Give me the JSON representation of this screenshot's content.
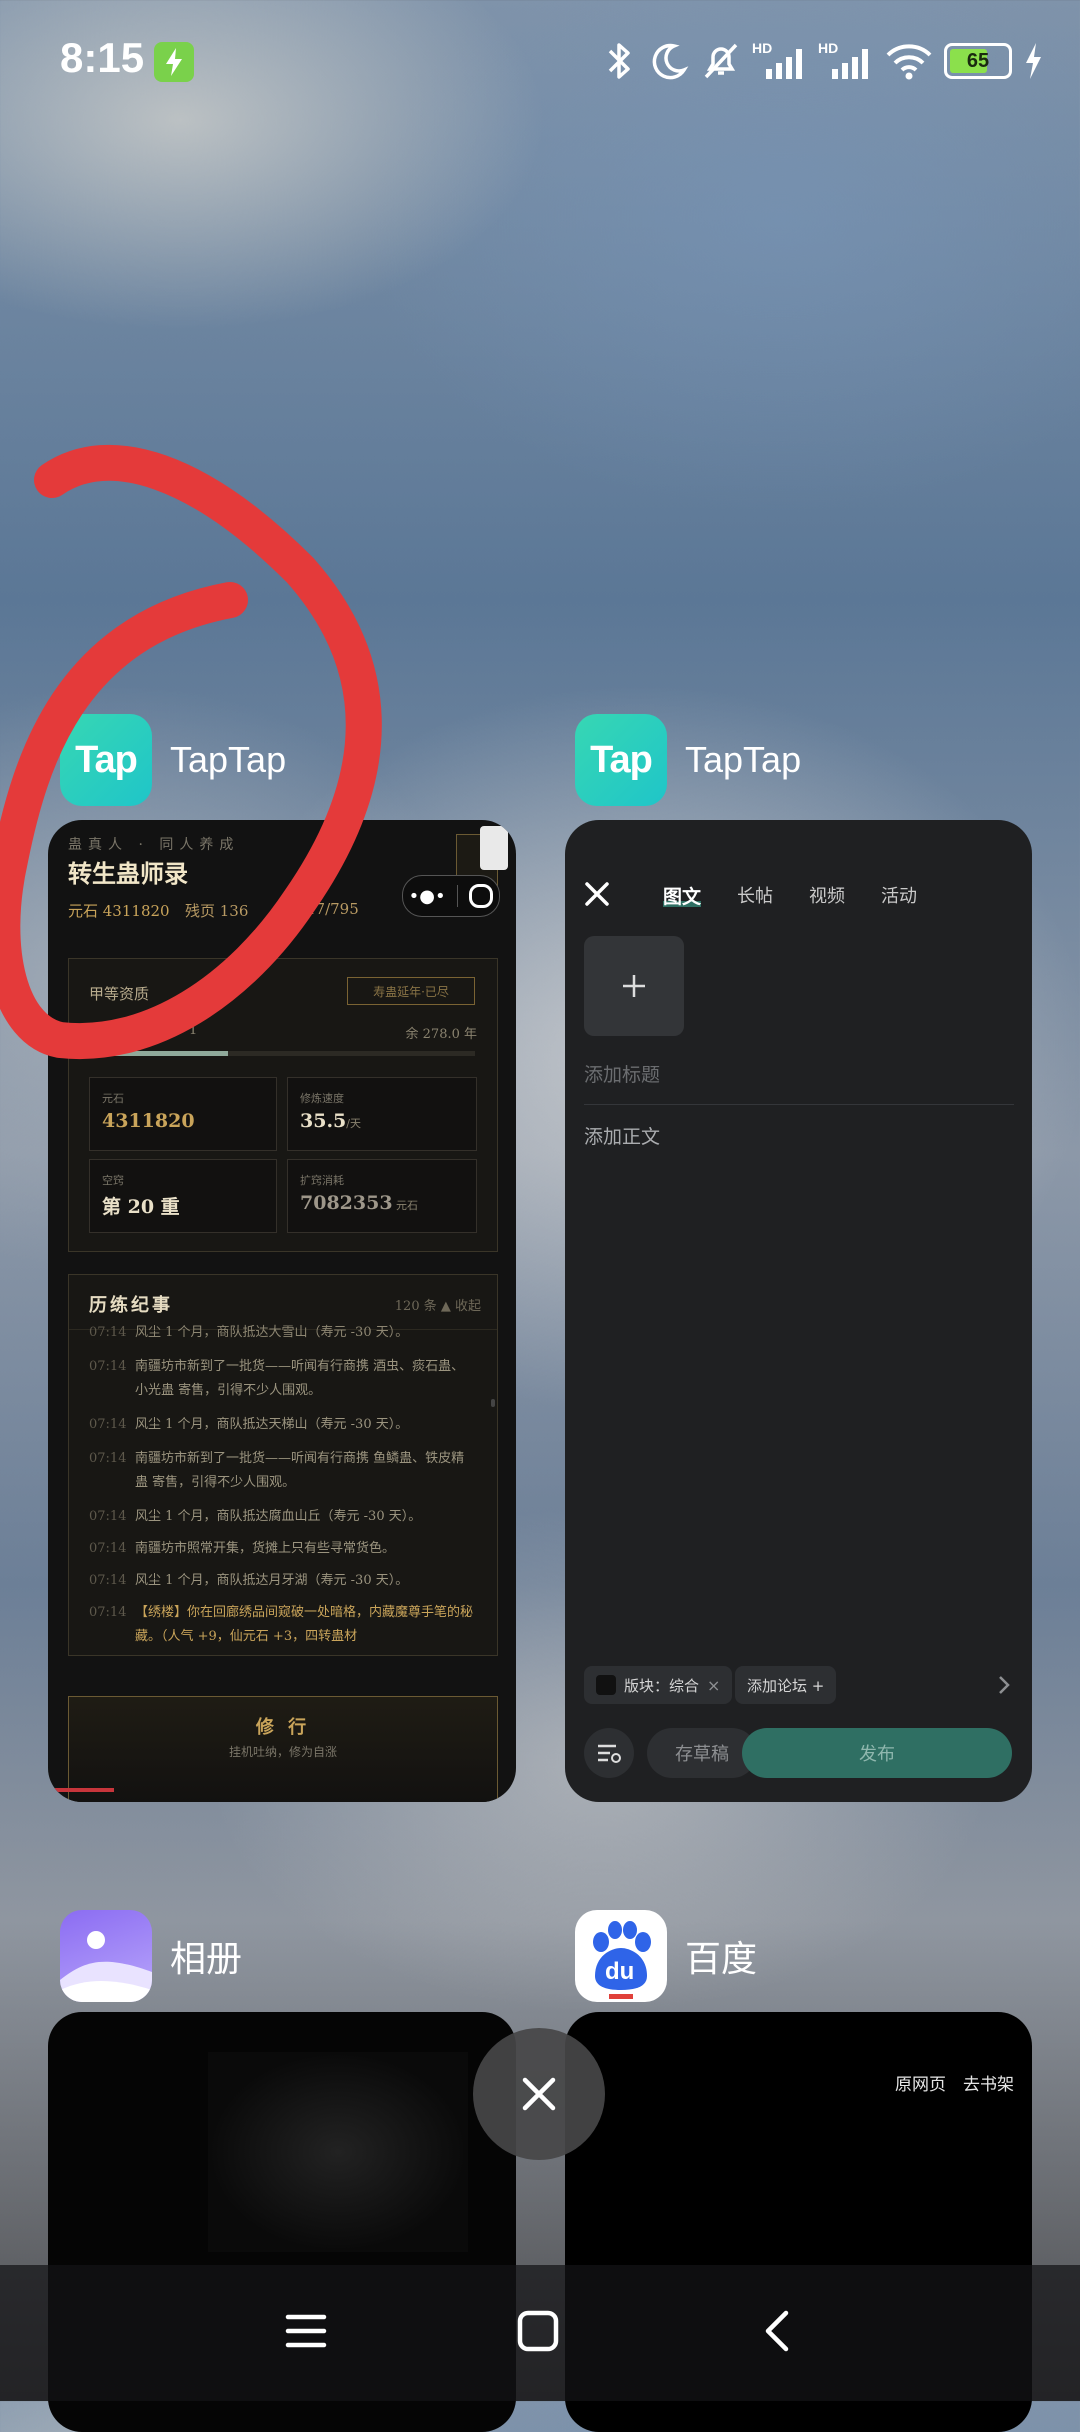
{
  "status": {
    "time": "8:15",
    "battery": "65"
  },
  "apps": [
    {
      "name": "TapTap",
      "icon_text": "Tap"
    },
    {
      "name": "TapTap",
      "icon_text": "Tap"
    },
    {
      "name": "相册"
    },
    {
      "name": "百度",
      "icon_text": "du"
    }
  ],
  "game": {
    "subtitle": "蛊真人 · 同人养成",
    "title": "转生蛊师录",
    "stats": {
      "yuanshi": "元石 4311820",
      "page": "残页 136",
      "extra": "17/795"
    },
    "aptitude": {
      "label": "甲等资质",
      "button": "寿蛊延年·已尽",
      "remain": "余 278.0 年",
      "lvl": "1",
      "progress": 0.36
    },
    "cells": [
      {
        "label": "元石",
        "value": "4311820",
        "unit": ""
      },
      {
        "label": "修炼速度",
        "value": "35.5",
        "unit": "/天"
      },
      {
        "label": "空窍",
        "value": "第 20 重",
        "unit": ""
      },
      {
        "label": "扩窍消耗",
        "value": "7082353",
        "unit": "元石"
      }
    ],
    "log": {
      "title": "历练纪事",
      "count": "120 条 ▲ 收起",
      "entries": [
        {
          "t": "07:14",
          "text": "风尘 1 个月，商队抵达大雪山（寿元 -30 天）。"
        },
        {
          "t": "07:14",
          "text": "南疆坊市新到了一批货——听闻有行商携 酒虫、痰石蛊、小光蛊 寄售，引得不少人围观。"
        },
        {
          "t": "07:14",
          "text": "风尘 1 个月，商队抵达天梯山（寿元 -30 天）。"
        },
        {
          "t": "07:14",
          "text": "南疆坊市新到了一批货——听闻有行商携 鱼鳞蛊、铁皮精蛊 寄售，引得不少人围观。"
        },
        {
          "t": "07:14",
          "text": "风尘 1 个月，商队抵达腐血山丘（寿元 -30 天）。"
        },
        {
          "t": "07:14",
          "text": "南疆坊市照常开集，货摊上只有些寻常货色。"
        },
        {
          "t": "07:14",
          "text": "风尘 1 个月，商队抵达月牙湖（寿元 -30 天）。"
        },
        {
          "t": "07:14",
          "text": "【绣楼】你在回廊绣品间窥破一处暗格，内藏魔尊手笔的秘藏。（人气 +9，仙元石 +3，四转蛊材"
        }
      ]
    },
    "cultivate": {
      "title": "修 行",
      "sub": "挂机吐纳，修为自涨"
    }
  },
  "editor": {
    "tabs": [
      "图文",
      "长帖",
      "视频",
      "活动"
    ],
    "title_placeholder": "添加标题",
    "body_placeholder": "添加正文",
    "forum_chip": "版块：综合",
    "add_forum": "添加论坛 +",
    "draft": "存草稿",
    "publish": "发布"
  },
  "baidu": {
    "link1": "原网页",
    "link2": "去书架"
  },
  "colors": {
    "teal": "#2f6f63",
    "accent": "#c9a45a",
    "annotation": "#e43a3a"
  }
}
